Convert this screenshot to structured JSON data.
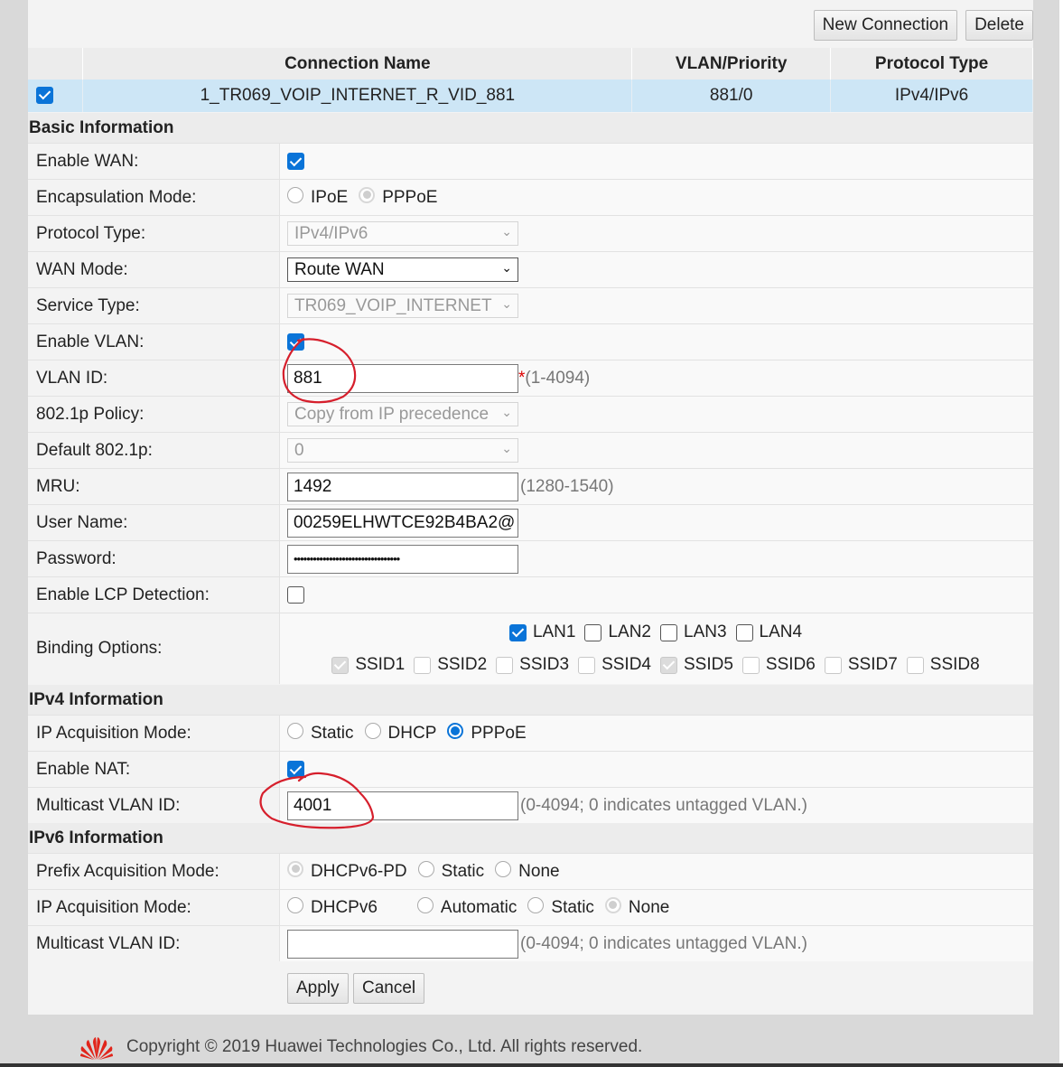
{
  "top_buttons": {
    "new_connection": "New Connection",
    "delete": "Delete"
  },
  "connection_table": {
    "headers": [
      "Connection Name",
      "VLAN/Priority",
      "Protocol Type"
    ],
    "row": {
      "selected": true,
      "name": "1_TR069_VOIP_INTERNET_R_VID_881",
      "vlan_priority": "881/0",
      "protocol_type": "IPv4/IPv6"
    }
  },
  "basic": {
    "title": "Basic Information",
    "enable_wan": {
      "label": "Enable WAN:",
      "checked": true
    },
    "encapsulation": {
      "label": "Encapsulation Mode:",
      "options": [
        "IPoE",
        "PPPoE"
      ],
      "selected": "PPPoE"
    },
    "protocol_type": {
      "label": "Protocol Type:",
      "value": "IPv4/IPv6"
    },
    "wan_mode": {
      "label": "WAN Mode:",
      "value": "Route WAN"
    },
    "service_type": {
      "label": "Service Type:",
      "value": "TR069_VOIP_INTERNET"
    },
    "enable_vlan": {
      "label": "Enable VLAN:",
      "checked": true
    },
    "vlan_id": {
      "label": "VLAN ID:",
      "value": "881",
      "required": "*",
      "hint": "(1-4094)"
    },
    "policy": {
      "label": "802.1p Policy:",
      "value": "Copy from IP precedence"
    },
    "default_8021p": {
      "label": "Default 802.1p:",
      "value": "0"
    },
    "mru": {
      "label": "MRU:",
      "value": "1492",
      "hint": "(1280-1540)"
    },
    "user_name": {
      "label": "User Name:",
      "value": "00259ELHWTCE92B4BA2@"
    },
    "password": {
      "label": "Password:",
      "value": "•••••••••••••••••••••••••••••••••"
    },
    "lcp": {
      "label": "Enable LCP Detection:",
      "checked": false
    },
    "binding": {
      "label": "Binding Options:",
      "lan": [
        {
          "name": "LAN1",
          "checked": true
        },
        {
          "name": "LAN2",
          "checked": false
        },
        {
          "name": "LAN3",
          "checked": false
        },
        {
          "name": "LAN4",
          "checked": false
        }
      ],
      "ssid": [
        {
          "name": "SSID1",
          "checked": true
        },
        {
          "name": "SSID2",
          "checked": false
        },
        {
          "name": "SSID3",
          "checked": false
        },
        {
          "name": "SSID4",
          "checked": false
        },
        {
          "name": "SSID5",
          "checked": true
        },
        {
          "name": "SSID6",
          "checked": false
        },
        {
          "name": "SSID7",
          "checked": false
        },
        {
          "name": "SSID8",
          "checked": false
        }
      ]
    }
  },
  "ipv4": {
    "title": "IPv4 Information",
    "ip_mode": {
      "label": "IP Acquisition Mode:",
      "options": [
        "Static",
        "DHCP",
        "PPPoE"
      ],
      "selected": "PPPoE"
    },
    "nat": {
      "label": "Enable NAT:",
      "checked": true
    },
    "multicast": {
      "label": "Multicast VLAN ID:",
      "value": "4001",
      "hint": "(0-4094; 0 indicates untagged VLAN.)"
    }
  },
  "ipv6": {
    "title": "IPv6 Information",
    "prefix_mode": {
      "label": "Prefix Acquisition Mode:",
      "options": [
        "DHCPv6-PD",
        "Static",
        "None"
      ],
      "selected": "DHCPv6-PD"
    },
    "ip_mode": {
      "label": "IP Acquisition Mode:",
      "options": [
        "DHCPv6",
        "Automatic",
        "Static",
        "None"
      ],
      "selected": "None"
    },
    "multicast": {
      "label": "Multicast VLAN ID:",
      "value": "",
      "hint": "(0-4094; 0 indicates untagged VLAN.)"
    }
  },
  "actions": {
    "apply": "Apply",
    "cancel": "Cancel"
  },
  "footer": {
    "copyright": "Copyright © 2019 Huawei Technologies Co., Ltd. All rights reserved."
  },
  "colors": {
    "accent": "#0a74d8",
    "selected_row": "#cde6f6",
    "annotation": "#d61f2c",
    "logo": "#e1251b"
  }
}
